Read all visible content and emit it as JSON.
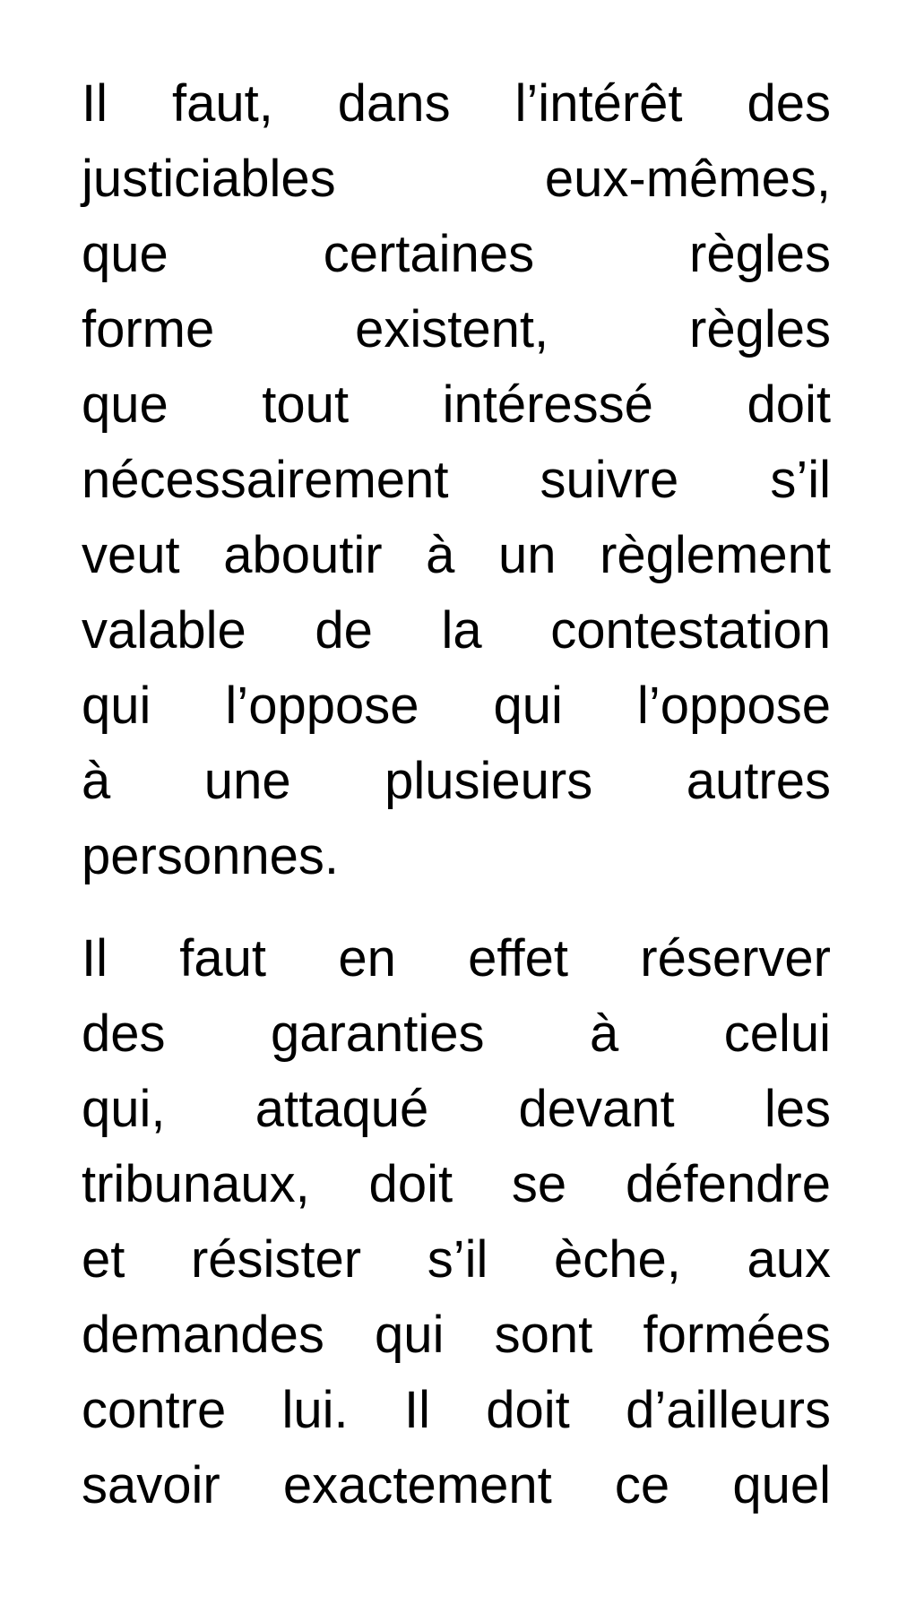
{
  "document": {
    "paragraphs": [
      {
        "lines": [
          "Il faut, dans l’intérêt des",
          "justiciables eux-mêmes,",
          "que certaines règles",
          "forme existent, règles",
          "que tout intéressé doit",
          "nécessairement suivre s’il",
          "veut aboutir à un règlement",
          "valable de la contestation",
          "qui l’oppose qui l’oppose",
          "à une plusieurs autres",
          "personnes."
        ]
      },
      {
        "lines": [
          "Il faut en effet réserver",
          "des garanties à celui",
          "qui, attaqué devant les",
          "tribunaux, doit se défendre",
          "et résister s’il èche, aux",
          "demandes qui sont formées",
          "contre lui. Il doit d’ailleurs",
          "savoir exactement ce quel"
        ]
      }
    ]
  }
}
